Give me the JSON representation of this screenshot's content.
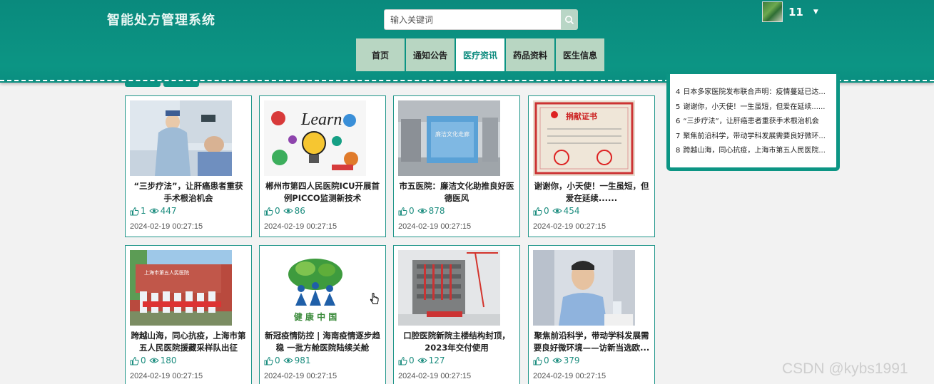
{
  "app": {
    "title": "智能处方管理系统"
  },
  "search": {
    "placeholder": "输入关键词"
  },
  "user": {
    "name": "11"
  },
  "nav": {
    "items": [
      {
        "label": "首页"
      },
      {
        "label": "通知公告"
      },
      {
        "label": "医疗资讯",
        "active": true
      },
      {
        "label": "药品资料"
      },
      {
        "label": "医生信息"
      }
    ]
  },
  "sidebar": {
    "items": [
      {
        "num": "4",
        "text": "日本多家医院发布联合声明：疫情蔓延已达..."
      },
      {
        "num": "5",
        "text": "谢谢你，小天使！一生虽短，但爱在延续......"
      },
      {
        "num": "6",
        "text": "“三步疗法”，让肝癌患者重获手术根治机会"
      },
      {
        "num": "7",
        "text": "聚焦前沿科学，带动学科发展需要良好微环..."
      },
      {
        "num": "8",
        "text": "跨越山海，同心抗疫，上海市第五人民医院..."
      }
    ]
  },
  "articles": [
    {
      "title": "“三步疗法”，让肝癌患者重获手术根治机会",
      "likes": "1",
      "views": "447",
      "date": "2024-02-19 00:27:15",
      "image": "doctor-treating-patient"
    },
    {
      "title": "郴州市第四人民医院ICU开展首例PICCO监测新技术",
      "likes": "0",
      "views": "86",
      "date": "2024-02-19 00:27:15",
      "image": "learn-lightbulb-illustration"
    },
    {
      "title": "市五医院：廉洁文化助推良好医德医风",
      "likes": "0",
      "views": "878",
      "date": "2024-02-19 00:27:15",
      "image": "hospital-corridor-display"
    },
    {
      "title": "谢谢你，小天使！一生虽短，但爱在延续......",
      "likes": "0",
      "views": "454",
      "date": "2024-02-19 00:27:15",
      "image": "donation-certificate"
    },
    {
      "title": "跨越山海，同心抗疫，上海市第五人民医院援藏采样队出征",
      "likes": "0",
      "views": "180",
      "date": "2024-02-19 00:27:15",
      "image": "medical-team-group-photo"
    },
    {
      "title": "新冠疫情防控 | 海南疫情逐步趋稳 一批方舱医院陆续关舱",
      "likes": "0",
      "views": "981",
      "date": "2024-02-19 00:27:15",
      "image": "health-china-logo",
      "image_text": "健 康 中 国"
    },
    {
      "title": "口腔医院新院主楼结构封顶，2023年交付使用",
      "likes": "0",
      "views": "127",
      "date": "2024-02-19 00:27:15",
      "image": "building-construction"
    },
    {
      "title": "聚焦前沿科学，带动学科发展需要良好微环境——访新当选欧...",
      "likes": "0",
      "views": "379",
      "date": "2024-02-19 00:27:15",
      "image": "speaker-portrait"
    }
  ],
  "watermark": "CSDN @kybs1991",
  "colors": {
    "primary": "#0c9584",
    "nav_bg": "#b8d6c2",
    "card_border": "#20968a"
  }
}
